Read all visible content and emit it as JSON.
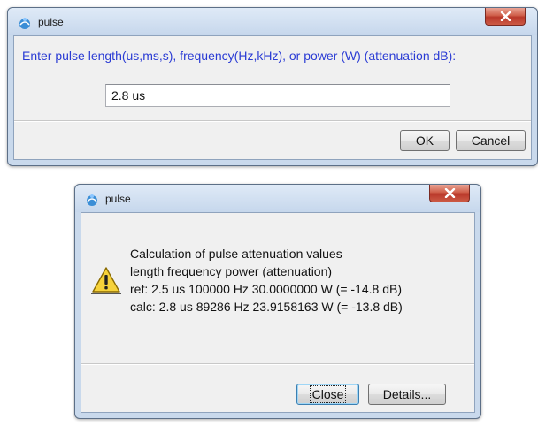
{
  "input_dialog": {
    "title": "pulse",
    "prompt": "Enter pulse length(us,ms,s), frequency(Hz,kHz), or power (W) (attenuation dB):",
    "input_value": "2.8 us",
    "ok_label": "OK",
    "cancel_label": "Cancel"
  },
  "result_dialog": {
    "title": "pulse",
    "message_lines": [
      "Calculation of pulse attenuation values",
      "length frequency power (attenuation)",
      "ref: 2.5 us 100000 Hz 30.0000000 W (= -14.8 dB)",
      "calc: 2.8 us 89286 Hz 23.9158163 W (= -13.8 dB)"
    ],
    "close_label": "Close",
    "details_label": "Details..."
  },
  "icons": {
    "app": "pulse-app-icon",
    "close": "close-icon",
    "warning": "warning-icon"
  },
  "colors": {
    "prompt_text": "#2a3bd4",
    "window_frame": "#c9d9ec",
    "close_button": "#c94a36"
  }
}
